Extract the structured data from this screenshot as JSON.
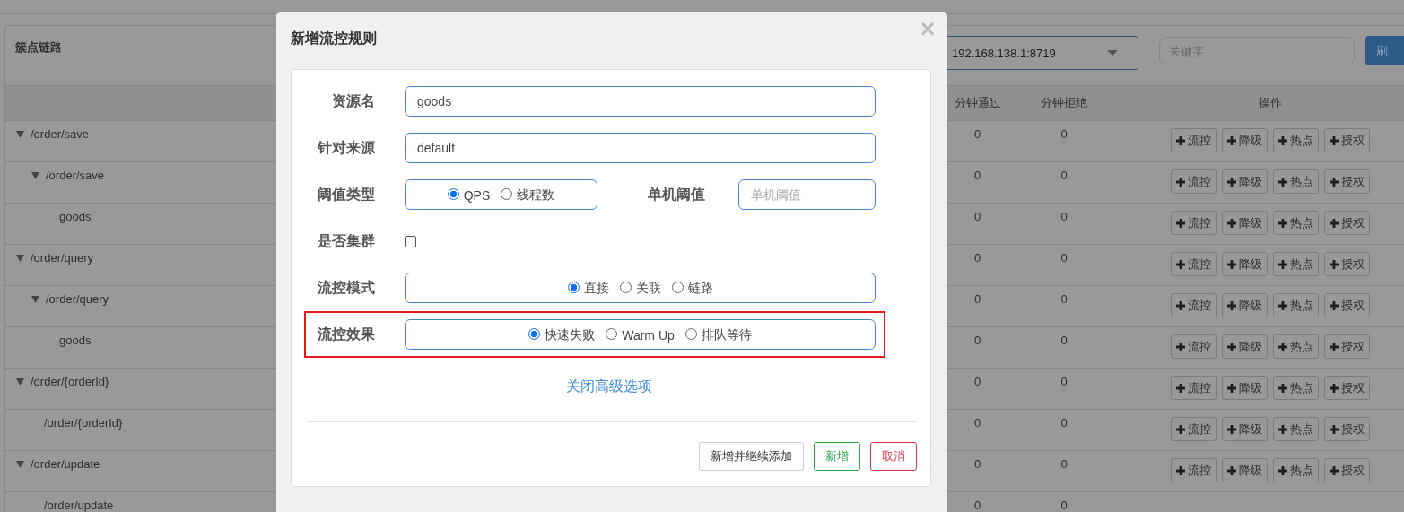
{
  "background_page": {
    "panel_title": "簇点链路",
    "machine_select": {
      "value": "192.168.138.1:8719"
    },
    "keyword_search": {
      "placeholder": "关键字"
    },
    "refresh_button": "刷",
    "table": {
      "columns": [
        "分钟通过",
        "分钟拒绝",
        "操作"
      ],
      "rows": [
        {
          "resource": "/order/save",
          "expanded": true,
          "pass": "0",
          "block": "0",
          "actions": [
            "流控",
            "降级",
            "热点",
            "授权"
          ],
          "children": [
            {
              "resource": "/order/save",
              "expanded": true,
              "pass": "0",
              "block": "0",
              "actions": [
                "流控",
                "降级",
                "热点",
                "授权"
              ],
              "children": [
                {
                  "resource": "goods",
                  "pass": "0",
                  "block": "0",
                  "actions": [
                    "流控",
                    "降级",
                    "热点",
                    "授权"
                  ]
                }
              ]
            }
          ]
        },
        {
          "resource": "/order/query",
          "expanded": true,
          "pass": "0",
          "block": "0",
          "actions": [
            "流控",
            "降级",
            "热点",
            "授权"
          ],
          "children": [
            {
              "resource": "/order/query",
              "expanded": true,
              "pass": "0",
              "block": "0",
              "actions": [
                "流控",
                "降级",
                "热点",
                "授权"
              ],
              "children": [
                {
                  "resource": "goods",
                  "pass": "0",
                  "block": "0",
                  "actions": [
                    "流控",
                    "降级",
                    "热点",
                    "授权"
                  ]
                }
              ]
            }
          ]
        },
        {
          "resource": "/order/{orderId}",
          "expanded": true,
          "pass": "0",
          "block": "0",
          "actions": [
            "流控",
            "降级",
            "热点",
            "授权"
          ],
          "children": [
            {
              "resource": "/order/{orderId}",
              "pass": "0",
              "block": "0",
              "actions": [
                "流控",
                "降级",
                "热点",
                "授权"
              ]
            }
          ]
        },
        {
          "resource": "/order/update",
          "expanded": true,
          "pass": "0",
          "block": "0",
          "actions": [
            "流控",
            "降级",
            "热点",
            "授权"
          ],
          "children": [
            {
              "resource": "/order/update",
              "pass": "0",
              "block": "0"
            }
          ]
        }
      ]
    }
  },
  "dialog": {
    "title": "新增流控规则",
    "close": "×",
    "fields": [
      {
        "kind": "text",
        "label": "资源名",
        "value": "goods",
        "highlighted": false
      },
      {
        "kind": "text",
        "label": "针对来源",
        "value": "default",
        "highlighted": false
      },
      {
        "kind": "radio_with_input",
        "label": "阈值类型",
        "options": [
          {
            "label": "QPS",
            "selected": true
          },
          {
            "label": "线程数",
            "selected": false
          }
        ],
        "side_label": "单机阈值",
        "side_placeholder": "单机阈值",
        "highlighted": false
      },
      {
        "kind": "checkbox",
        "label": "是否集群",
        "checked": false,
        "highlighted": false
      },
      {
        "kind": "radio",
        "label": "流控模式",
        "options": [
          {
            "label": "直接",
            "selected": true
          },
          {
            "label": "关联",
            "selected": false
          },
          {
            "label": "链路",
            "selected": false
          }
        ],
        "highlighted": false
      },
      {
        "kind": "radio",
        "label": "流控效果",
        "options": [
          {
            "label": "快速失败",
            "selected": true
          },
          {
            "label": "Warm Up",
            "selected": false
          },
          {
            "label": "排队等待",
            "selected": false
          }
        ],
        "highlighted": true
      }
    ],
    "advanced_link": "关闭高级选项",
    "buttons": [
      {
        "label": "新增并继续添加",
        "kind": "default"
      },
      {
        "label": "新增",
        "kind": "success"
      },
      {
        "label": "取消",
        "kind": "danger"
      }
    ]
  }
}
